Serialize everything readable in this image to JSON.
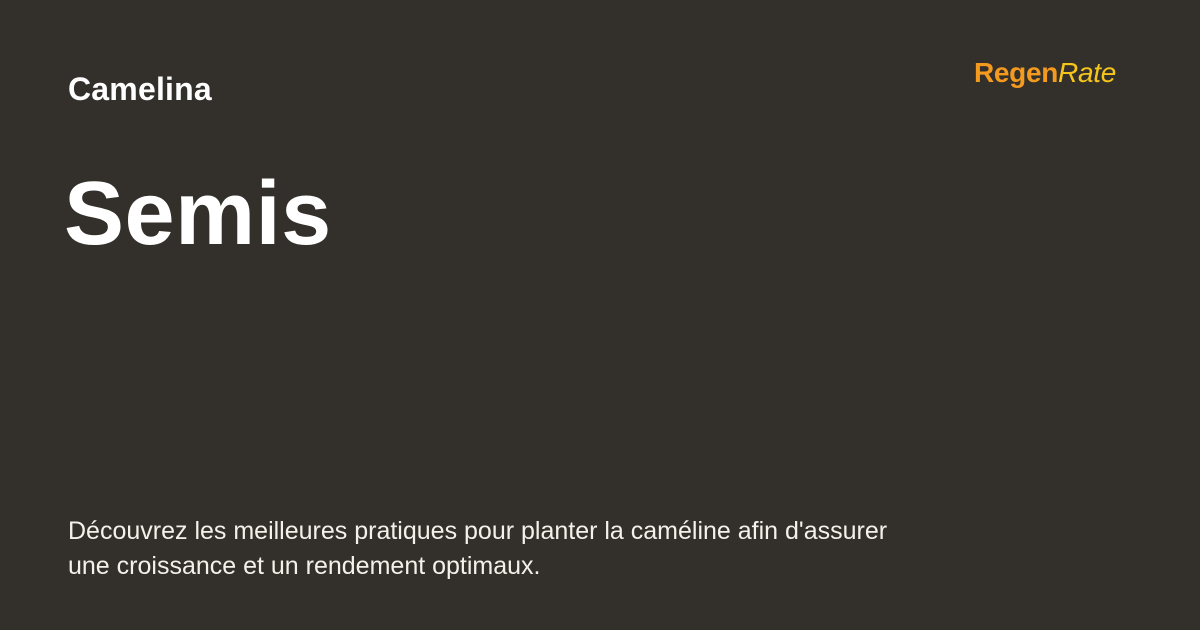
{
  "header": {
    "category": "Camelina",
    "title": "Semis"
  },
  "brand": {
    "regen_text": "Regen",
    "rate_text": "Rate",
    "colors": {
      "regen": "#f39a1f",
      "rate": "#f5c51c",
      "background": "#33302b"
    }
  },
  "content": {
    "description": "Découvrez les meilleures pratiques pour planter la caméline afin d'assurer une croissance et un rendement optimaux."
  }
}
